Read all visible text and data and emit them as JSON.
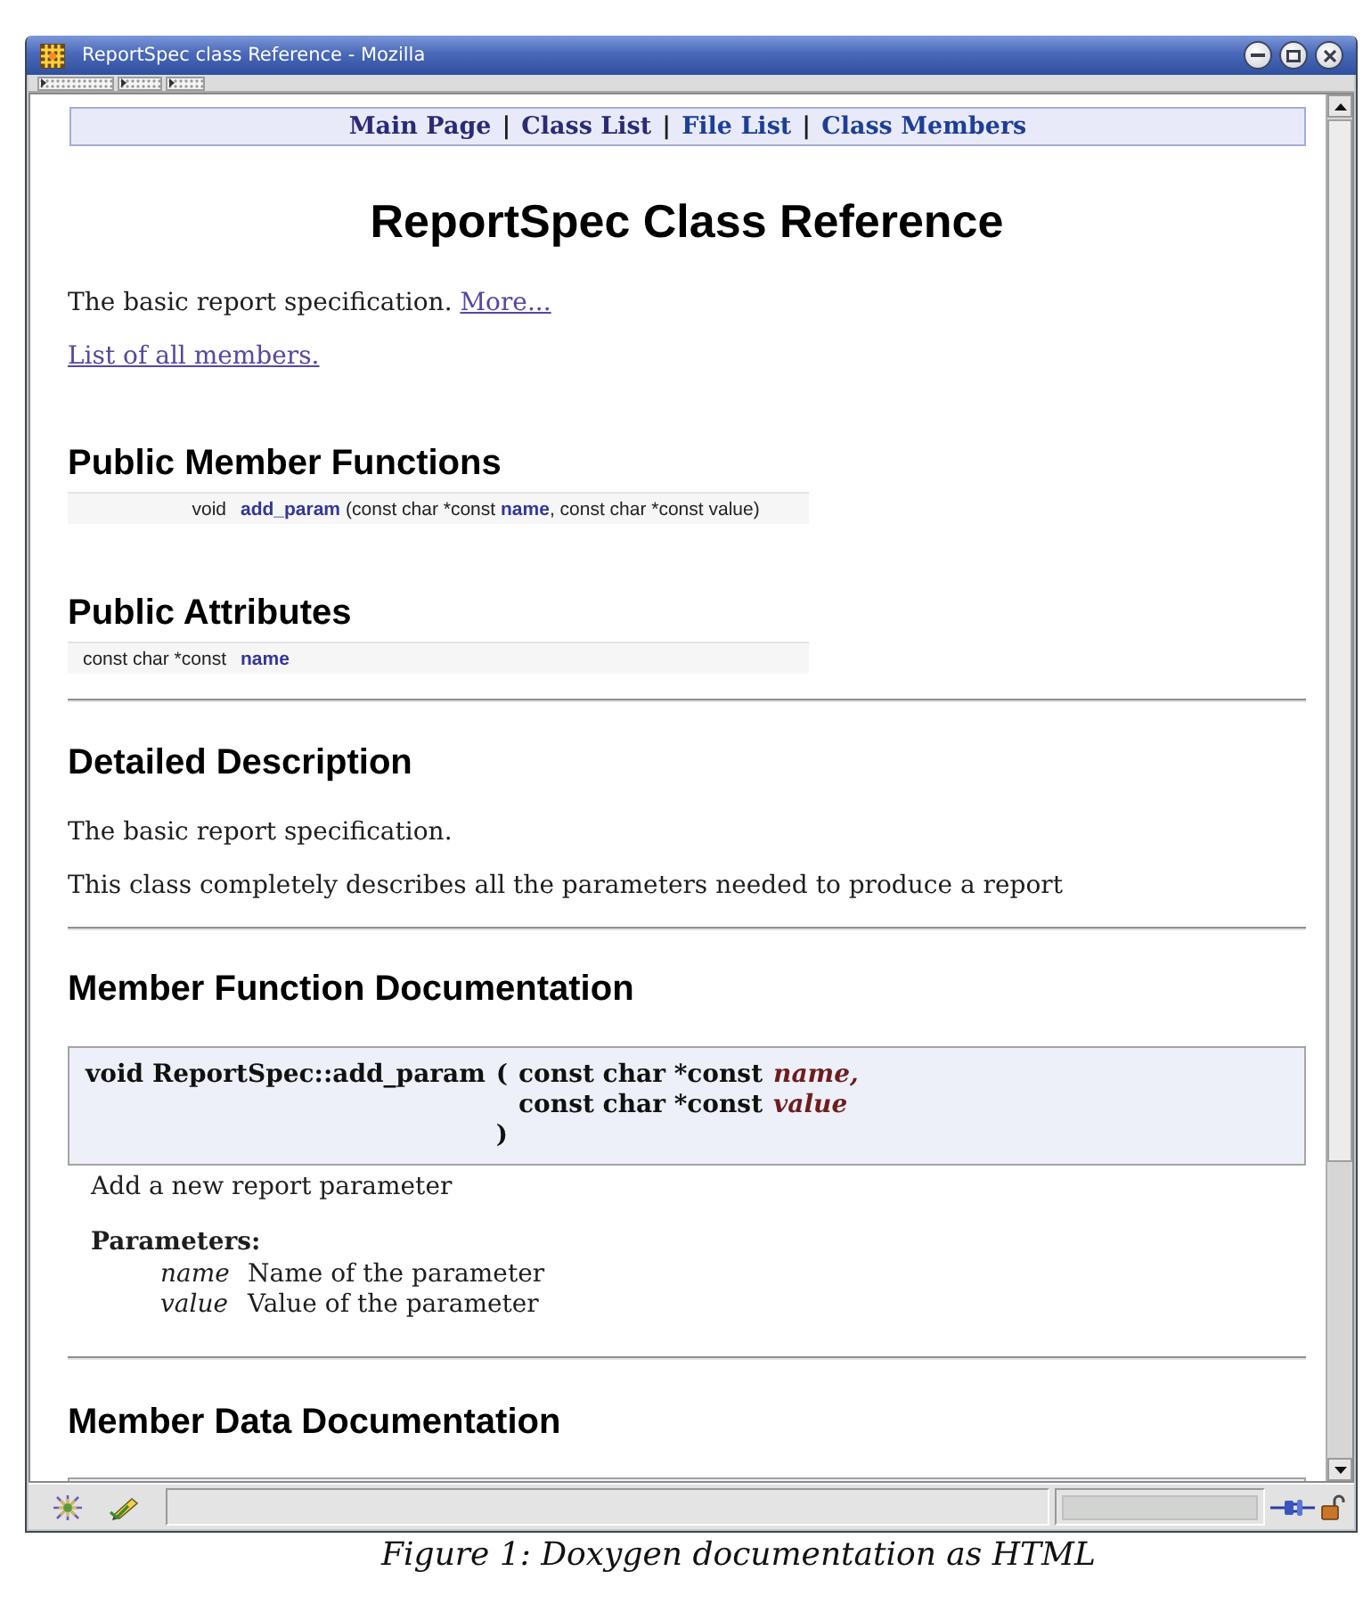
{
  "window": {
    "title": "ReportSpec class Reference - Mozilla"
  },
  "nav_bar": {
    "items": [
      {
        "kind": "link",
        "text": "Main Page",
        "visited": true
      },
      {
        "kind": "separator",
        "text": "|"
      },
      {
        "kind": "link",
        "text": "Class List",
        "visited": true
      },
      {
        "kind": "separator",
        "text": "|"
      },
      {
        "kind": "link",
        "text": "File List",
        "visited": false
      },
      {
        "kind": "separator",
        "text": "|"
      },
      {
        "kind": "link",
        "text": "Class Members",
        "visited": false
      }
    ]
  },
  "page": {
    "title": "ReportSpec Class Reference",
    "brief": {
      "text": "The basic report specification.",
      "more_link": "More..."
    },
    "members_link": "List of all members.",
    "sections": [
      {
        "kind": "member_table",
        "heading": "Public Member Functions",
        "rows": [
          {
            "type": "void",
            "link": "add_param",
            "args_before": "(const char *const",
            "arg_link": "name",
            "args_after": ", const char *const value)"
          }
        ]
      },
      {
        "kind": "member_table",
        "heading": "Public Attributes",
        "rows": [
          {
            "type": "const char *const",
            "link": "name"
          }
        ]
      },
      {
        "kind": "description",
        "heading": "Detailed Description",
        "paragraphs": [
          "The basic report specification.",
          "This class completely describes all the parameters needed to produce a report"
        ]
      },
      {
        "kind": "function_doc",
        "heading": "Member Function Documentation",
        "signature": {
          "name": "void ReportSpec::add_param",
          "open": "(",
          "params": [
            {
              "type": "const char *const",
              "name": "name,"
            },
            {
              "type": "const char *const",
              "name": "value"
            }
          ],
          "close": ")"
        },
        "description": "Add a new report parameter",
        "params_label": "Parameters:",
        "params": [
          {
            "name": "name",
            "description": "Name of the parameter"
          },
          {
            "name": "value",
            "description": "Value of the parameter"
          }
        ]
      },
      {
        "kind": "data_doc",
        "heading": "Member Data Documentation"
      }
    ]
  },
  "caption": "Figure 1: Doxygen documentation as HTML"
}
